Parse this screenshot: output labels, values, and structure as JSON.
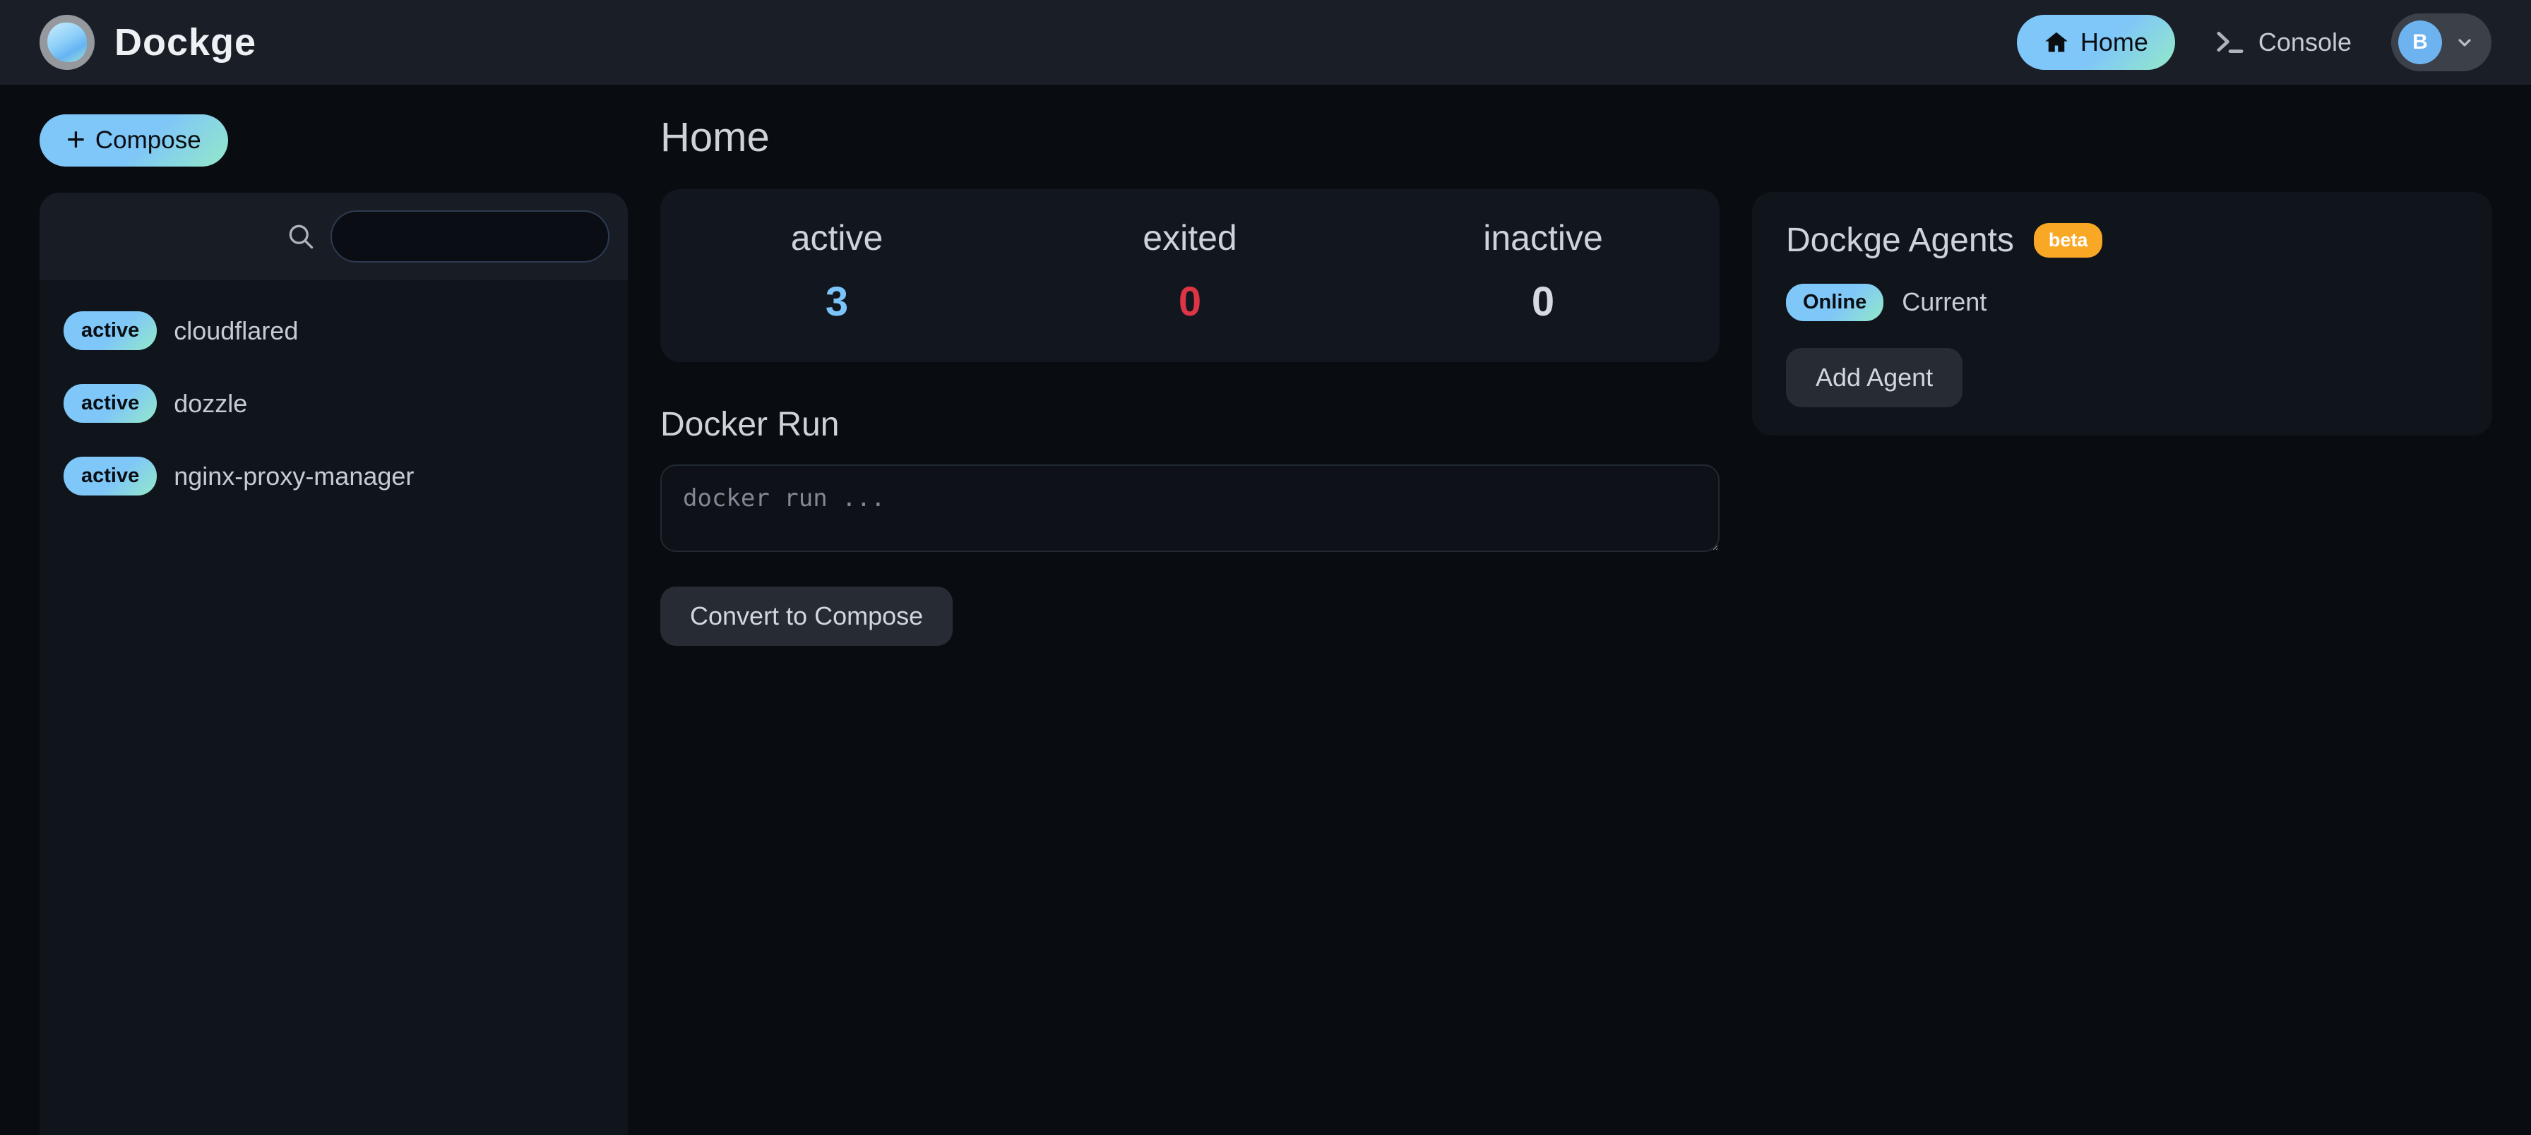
{
  "navbar": {
    "brand": "Dockge",
    "home_label": "Home",
    "console_label": "Console",
    "avatar_initial": "B"
  },
  "sidebar": {
    "compose_label": "Compose",
    "search": {
      "value": "",
      "placeholder": ""
    },
    "stacks": [
      {
        "status": "active",
        "name": "cloudflared"
      },
      {
        "status": "active",
        "name": "dozzle"
      },
      {
        "status": "active",
        "name": "nginx-proxy-manager"
      }
    ]
  },
  "main": {
    "title": "Home",
    "stats": [
      {
        "label": "active",
        "value": "3",
        "color": "#7cc5fa"
      },
      {
        "label": "exited",
        "value": "0",
        "color": "#dc3545"
      },
      {
        "label": "inactive",
        "value": "0",
        "color": "#d6dae0"
      }
    ],
    "docker_run": {
      "title": "Docker Run",
      "placeholder": "docker run ...",
      "value": "",
      "convert_label": "Convert to Compose"
    }
  },
  "agents": {
    "title": "Dockge Agents",
    "beta_label": "beta",
    "status_badge": "Online",
    "agent_name": "Current",
    "add_label": "Add Agent"
  },
  "colors": {
    "accent_gradient_start": "#7fc6f9",
    "accent_gradient_end": "#93e9c8",
    "navbar_bg": "#1a1e27",
    "page_bg": "#090c11",
    "panel_bg": "#10141b",
    "beta_badge_bg": "#f9a826",
    "danger": "#dc3545"
  }
}
